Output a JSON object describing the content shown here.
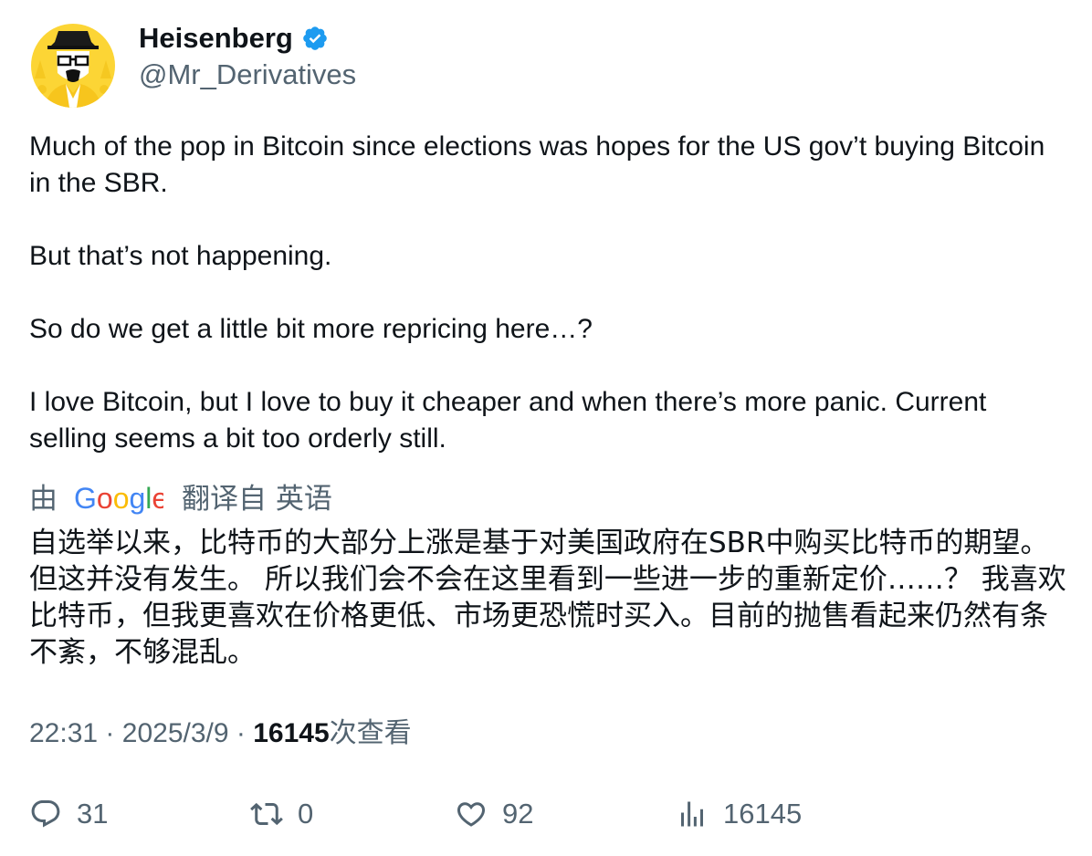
{
  "author": {
    "display_name": "Heisenberg",
    "handle": "@Mr_Derivatives",
    "verified": true
  },
  "tweet": {
    "paragraphs": [
      "Much of the pop in Bitcoin since elections was hopes for the US gov’t buying Bitcoin in the SBR.",
      "But that’s not happening.",
      "So do we get a little bit more repricing here…?",
      "I love Bitcoin, but I love to buy it cheaper and when there’s more panic. Current selling seems a bit too orderly still."
    ]
  },
  "translation": {
    "by_label": "由",
    "provider": "Google",
    "from_label": "翻译自 英语",
    "text": "自选举以来，比特币的大部分上涨是基于对美国政府在SBR中购买比特币的期望。 但这并没有发生。 所以我们会不会在这里看到一些进一步的重新定价……？ 我喜欢比特币，但我更喜欢在价格更低、市场更恐慌时买入。目前的抛售看起来仍然有条不紊，不够混乱。"
  },
  "meta": {
    "time": "22:31",
    "date": "2025/3/9",
    "views_count": "16145",
    "views_label": "次查看",
    "separator": "·"
  },
  "actions": {
    "replies": "31",
    "reposts": "0",
    "likes": "92",
    "views": "16145"
  },
  "colors": {
    "text": "#0f1419",
    "secondary": "#536471",
    "verified_blue": "#1d9bf0",
    "avatar_yellow": "#fcd535"
  },
  "icons": [
    "verified-badge-icon",
    "google-logo",
    "reply-icon",
    "repost-icon",
    "like-icon",
    "views-icon"
  ]
}
